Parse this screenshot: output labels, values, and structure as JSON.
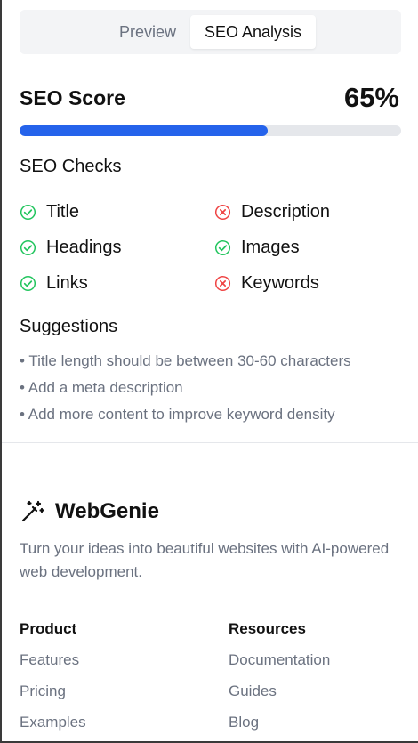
{
  "tabs": [
    {
      "label": "Preview"
    },
    {
      "label": "SEO Analysis"
    }
  ],
  "seo": {
    "score_label": "SEO Score",
    "score_value": "65%",
    "score_fraction": 0.65,
    "progress_color": "#2563eb",
    "checks_title": "SEO Checks",
    "checks": [
      {
        "label": "Title",
        "status": "pass"
      },
      {
        "label": "Description",
        "status": "fail"
      },
      {
        "label": "Headings",
        "status": "pass"
      },
      {
        "label": "Images",
        "status": "pass"
      },
      {
        "label": "Links",
        "status": "pass"
      },
      {
        "label": "Keywords",
        "status": "fail"
      }
    ],
    "pass_color": "#22c55e",
    "fail_color": "#ef4444",
    "suggestions_title": "Suggestions",
    "suggestions": [
      "Title length should be between 30-60 characters",
      "Add a meta description",
      "Add more content to improve keyword density"
    ]
  },
  "footer": {
    "brand_icon": "magic-wand-icon",
    "brand": "WebGenie",
    "tagline": "Turn your ideas into beautiful websites with AI-powered web development.",
    "product": {
      "title": "Product",
      "links": [
        "Features",
        "Pricing",
        "Examples"
      ]
    },
    "resources": {
      "title": "Resources",
      "links": [
        "Documentation",
        "Guides",
        "Blog"
      ]
    }
  }
}
